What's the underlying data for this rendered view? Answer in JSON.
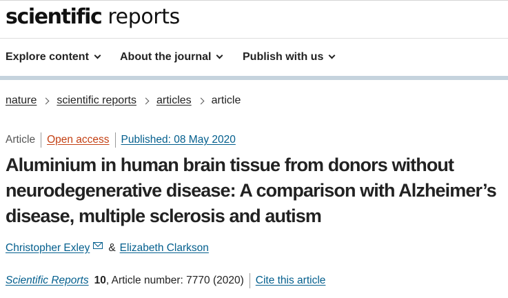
{
  "header": {
    "logo_bold": "scientific",
    "logo_light": "reports"
  },
  "nav": {
    "items": [
      {
        "label": "Explore content"
      },
      {
        "label": "About the journal"
      },
      {
        "label": "Publish with us"
      }
    ]
  },
  "breadcrumb": {
    "items": [
      "nature",
      "scientific reports",
      "articles"
    ],
    "current": "article"
  },
  "article": {
    "type": "Article",
    "access": "Open access",
    "published": "Published: 08 May 2020",
    "title": "Aluminium in human brain tissue from donors without neurodegenerative disease: A comparison with Alzheimer’s disease, multiple sclerosis and autism",
    "authors": [
      "Christopher Exley",
      "Elizabeth Clarkson"
    ],
    "author_separator": "&",
    "journal": "Scientific Reports",
    "volume": "10",
    "article_info": ", Article number: 7770 (2020)",
    "cite_label": "Cite this article"
  },
  "colors": {
    "link": "#025e8d",
    "open_access": "#c33f12",
    "text": "#222222",
    "nav_shadow": "#c5d3dd"
  },
  "icons": [
    "chevron-down-icon",
    "chevron-right-icon",
    "mail-icon"
  ]
}
